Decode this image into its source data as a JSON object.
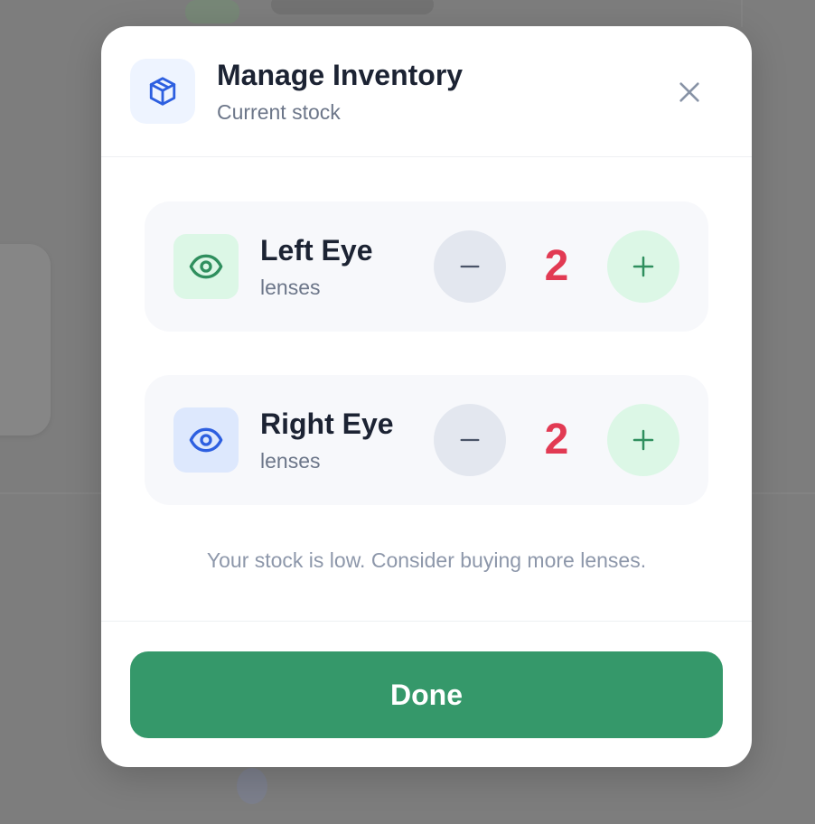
{
  "modal": {
    "title": "Manage Inventory",
    "subtitle": "Current stock",
    "header_icon": "package-box-icon",
    "close_icon": "close-icon"
  },
  "items": [
    {
      "name": "Left Eye",
      "unit": "lenses",
      "count": "2",
      "icon": "eye-icon",
      "icon_color": "#2f8f5e",
      "icon_bg": "#dcf7e6"
    },
    {
      "name": "Right Eye",
      "unit": "lenses",
      "count": "2",
      "icon": "eye-icon",
      "icon_color": "#2d5fe0",
      "icon_bg": "#dde8fd"
    }
  ],
  "controls": {
    "decrement_icon": "minus-icon",
    "increment_icon": "plus-icon"
  },
  "note": "Your stock is low. Consider buying more lenses.",
  "done_label": "Done",
  "colors": {
    "primary": "#35986a",
    "low_stock": "#e23a53",
    "accent_blue": "#2d5fe0"
  }
}
